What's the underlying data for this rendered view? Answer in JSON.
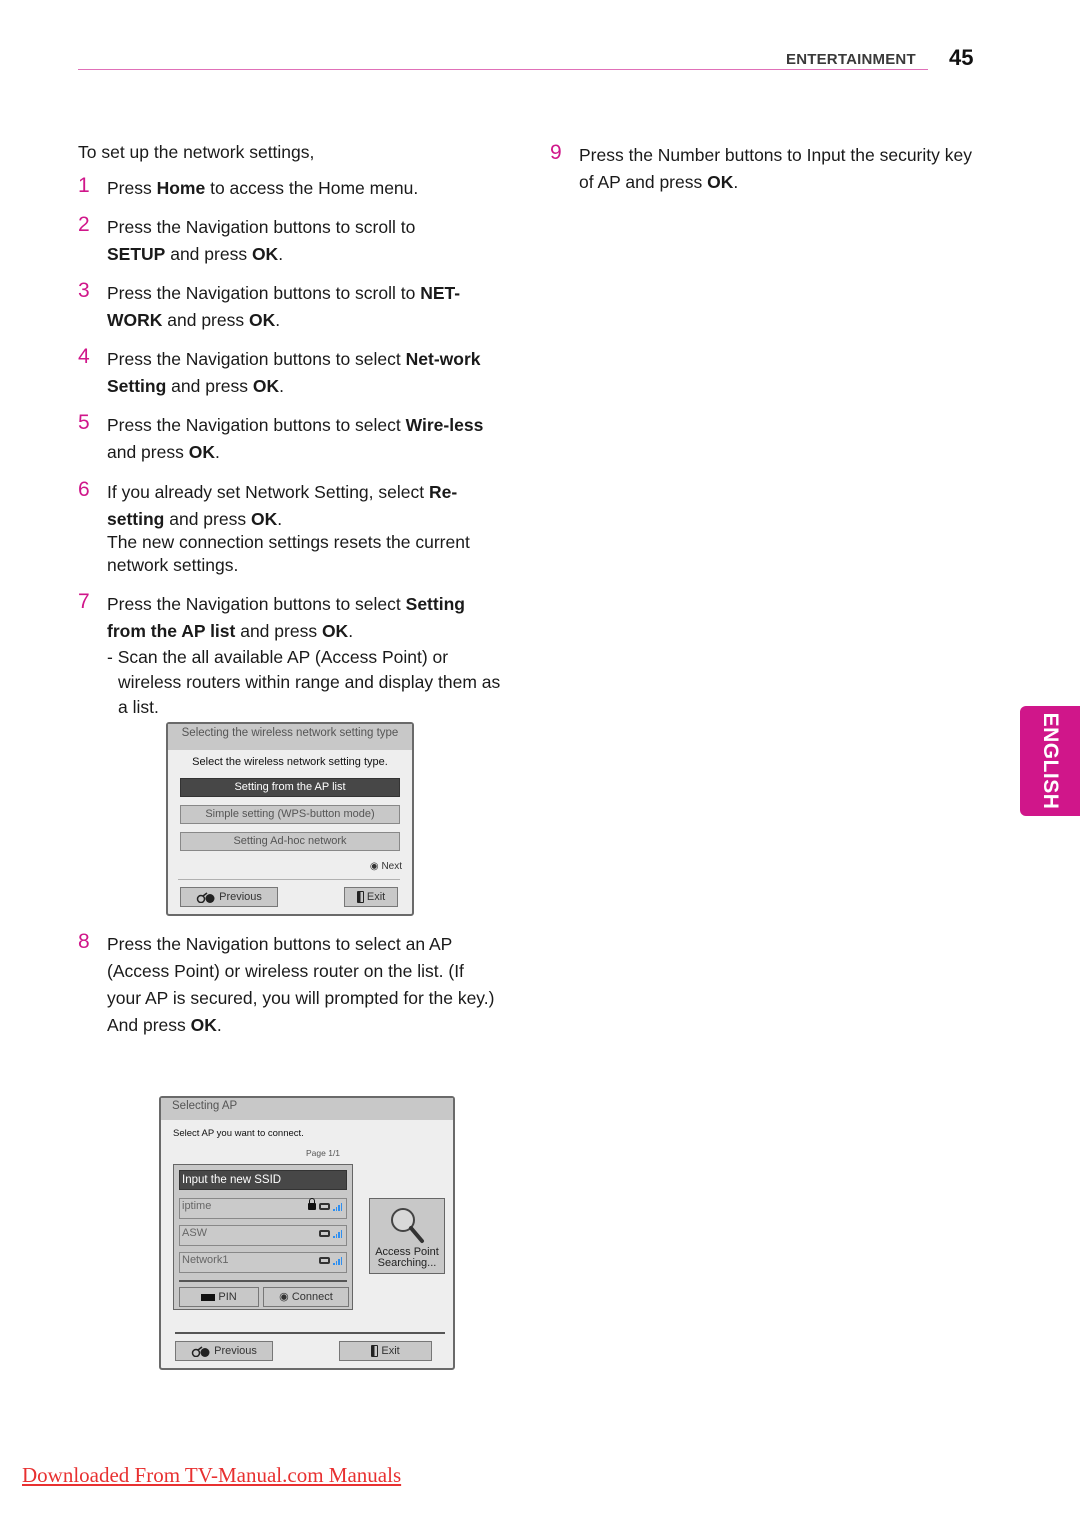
{
  "header": {
    "section": "ENTERTAINMENT",
    "page_number": "45",
    "accent_color": "#d0168a"
  },
  "intro": "To set up the network settings,",
  "steps": [
    {
      "num": "1",
      "parts": [
        [
          "Press ",
          false
        ],
        [
          "Home",
          true
        ],
        [
          " to access the Home menu.",
          false
        ]
      ]
    },
    {
      "num": "2",
      "parts": [
        [
          "Press the Navigation buttons to scroll to ",
          false
        ],
        [
          "SETUP",
          true
        ],
        [
          " and press ",
          false
        ],
        [
          "OK",
          true
        ],
        [
          ".",
          false
        ]
      ]
    },
    {
      "num": "3",
      "parts": [
        [
          "Press the Navigation buttons to scroll to ",
          false
        ],
        [
          "NET-WORK",
          true
        ],
        [
          " and press ",
          false
        ],
        [
          "OK",
          true
        ],
        [
          ".",
          false
        ]
      ]
    },
    {
      "num": "4",
      "parts": [
        [
          "Press the Navigation buttons to select ",
          false
        ],
        [
          "Net-work Setting",
          true
        ],
        [
          " and press ",
          false
        ],
        [
          "OK",
          true
        ],
        [
          ".",
          false
        ]
      ]
    },
    {
      "num": "5",
      "parts": [
        [
          "Press the Navigation buttons to select ",
          false
        ],
        [
          "Wire-less",
          true
        ],
        [
          " and press ",
          false
        ],
        [
          "OK",
          true
        ],
        [
          ".",
          false
        ]
      ]
    },
    {
      "num": "6",
      "parts": [
        [
          "If you already set Network Setting, select ",
          false
        ],
        [
          "Re-setting",
          true
        ],
        [
          " and press ",
          false
        ],
        [
          "OK",
          true
        ],
        [
          ".",
          false
        ]
      ],
      "note": "The new connection settings resets the current network settings."
    },
    {
      "num": "7",
      "parts": [
        [
          "Press the Navigation buttons to select ",
          false
        ],
        [
          "Setting from the AP list",
          true
        ],
        [
          " and press ",
          false
        ],
        [
          "OK",
          true
        ],
        [
          ".",
          false
        ]
      ],
      "bullet": "- Scan the all available AP (Access Point) or wireless routers within range and display them as a list."
    },
    {
      "num": "8",
      "parts": [
        [
          "Press the Navigation buttons to select an AP (Access Point) or wireless router on the list. (If your AP is secured, you will prompted for the key.) And press ",
          false
        ],
        [
          "OK",
          true
        ],
        [
          ".",
          false
        ]
      ]
    },
    {
      "num": "9",
      "parts": [
        [
          "Press the Number buttons to Input the security key of AP and press ",
          false
        ],
        [
          "OK",
          true
        ],
        [
          ".",
          false
        ]
      ]
    }
  ],
  "dialog_setting_type": {
    "title": "Selecting the wireless network setting type",
    "prompt": "Select the wireless network setting type.",
    "options": [
      {
        "label": "Setting from the AP list",
        "selected": true
      },
      {
        "label": "Simple setting (WPS-button mode)",
        "selected": false
      },
      {
        "label": "Setting Ad-hoc network",
        "selected": false
      }
    ],
    "next_label": "Next",
    "previous_label": "Previous",
    "exit_label": "Exit"
  },
  "dialog_selecting_ap": {
    "title": "Selecting AP",
    "prompt": "Select AP you want to connect.",
    "page": "Page 1/1",
    "ssid_input": "Input the new SSID",
    "access_points": [
      {
        "name": "iptime",
        "secured": true,
        "signal_color": "#2e8ff0"
      },
      {
        "name": "ASW",
        "secured": false,
        "signal_color": "#2e8ff0"
      },
      {
        "name": "Network1",
        "secured": false,
        "signal_color": "#2e8ff0"
      }
    ],
    "pin_label": "PIN",
    "connect_label": "Connect",
    "search_status_line1": "Access Point",
    "search_status_line2": "Searching...",
    "previous_label": "Previous",
    "exit_label": "Exit"
  },
  "language_tab": "ENGLISH",
  "footer_link": "Downloaded From TV-Manual.com Manuals"
}
